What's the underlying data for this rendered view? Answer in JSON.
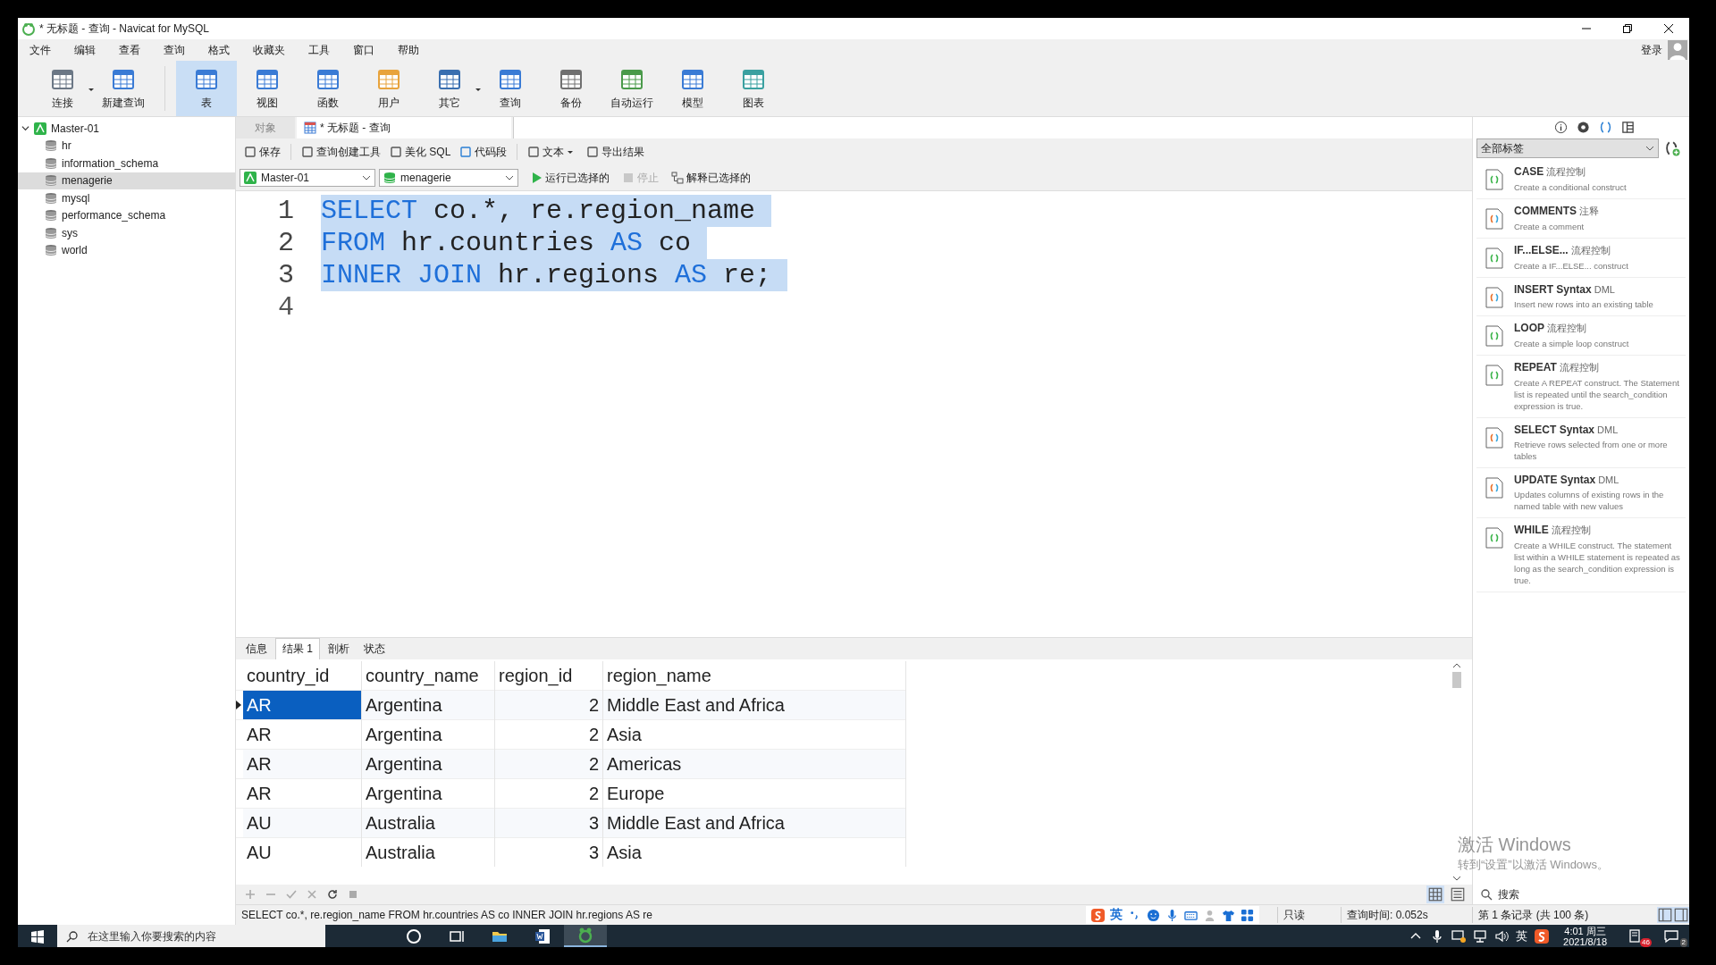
{
  "window": {
    "title": "* 无标题 - 查询 - Navicat for MySQL"
  },
  "menu": [
    "文件",
    "编辑",
    "查看",
    "查询",
    "格式",
    "收藏夹",
    "工具",
    "窗口",
    "帮助"
  ],
  "login": "登录",
  "toolbar": [
    {
      "label": "连接",
      "selected": false,
      "dropdown": true
    },
    {
      "label": "新建查询",
      "selected": false,
      "dropdown": false
    },
    {
      "label": "表",
      "selected": true,
      "dropdown": false
    },
    {
      "label": "视图",
      "selected": false,
      "dropdown": false
    },
    {
      "label": "函数",
      "selected": false,
      "dropdown": false
    },
    {
      "label": "用户",
      "selected": false,
      "dropdown": false
    },
    {
      "label": "其它",
      "selected": false,
      "dropdown": true
    },
    {
      "label": "查询",
      "selected": false,
      "dropdown": false
    },
    {
      "label": "备份",
      "selected": false,
      "dropdown": false
    },
    {
      "label": "自动运行",
      "selected": false,
      "dropdown": false
    },
    {
      "label": "模型",
      "selected": false,
      "dropdown": false
    },
    {
      "label": "图表",
      "selected": false,
      "dropdown": false
    }
  ],
  "tree": {
    "label": "Master-01",
    "expanded": true,
    "children": [
      {
        "label": "hr",
        "selected": false
      },
      {
        "label": "information_schema",
        "selected": false
      },
      {
        "label": "menagerie",
        "selected": true
      },
      {
        "label": "mysql",
        "selected": false
      },
      {
        "label": "performance_schema",
        "selected": false
      },
      {
        "label": "sys",
        "selected": false
      },
      {
        "label": "world",
        "selected": false
      }
    ]
  },
  "doc_tabs": [
    {
      "label": "对象",
      "selected": false
    },
    {
      "label": "* 无标题 - 查询",
      "selected": true
    }
  ],
  "query_toolbar": [
    {
      "label": "保存",
      "dropdown": false
    },
    {
      "label": "查询创建工具",
      "dropdown": false
    },
    {
      "label": "美化 SQL",
      "dropdown": false
    },
    {
      "label": "代码段",
      "dropdown": false
    },
    {
      "label": "文本",
      "dropdown": true
    },
    {
      "label": "导出结果",
      "dropdown": false
    }
  ],
  "connection": "Master-01",
  "database": "menagerie",
  "run_actions": [
    {
      "label": "运行已选择的",
      "disabled": false
    },
    {
      "label": "停止",
      "disabled": true
    },
    {
      "label": "解释已选择的",
      "disabled": false
    }
  ],
  "editor": {
    "lines": [
      {
        "number": "1",
        "selected": true,
        "tokens": [
          {
            "kind": "keyword",
            "text": "SELECT"
          },
          {
            "kind": "plain",
            "text": " co.*, re.region_name"
          }
        ]
      },
      {
        "number": "2",
        "selected": true,
        "tokens": [
          {
            "kind": "keyword",
            "text": "FROM"
          },
          {
            "kind": "plain",
            "text": " hr.countries "
          },
          {
            "kind": "keyword",
            "text": "AS"
          },
          {
            "kind": "plain",
            "text": " co"
          }
        ]
      },
      {
        "number": "3",
        "selected": true,
        "tokens": [
          {
            "kind": "keyword",
            "text": "INNER JOIN"
          },
          {
            "kind": "plain",
            "text": " hr.regions "
          },
          {
            "kind": "keyword",
            "text": "AS"
          },
          {
            "kind": "plain",
            "text": " re;"
          }
        ]
      },
      {
        "number": "4",
        "selected": false
      }
    ]
  },
  "result_tabs": [
    {
      "label": "信息",
      "selected": false
    },
    {
      "label": "结果 1",
      "selected": true
    },
    {
      "label": "剖析",
      "selected": false
    },
    {
      "label": "状态",
      "selected": false
    }
  ],
  "grid": {
    "columns": [
      {
        "label": "country_id",
        "numeric": false
      },
      {
        "label": "country_name",
        "numeric": false
      },
      {
        "label": "region_id",
        "numeric": true
      },
      {
        "label": "region_name",
        "numeric": false
      }
    ],
    "rows": [
      {
        "cells": [
          "AR",
          "Argentina",
          "2",
          "Middle East and Africa"
        ],
        "current": true
      },
      {
        "cells": [
          "AR",
          "Argentina",
          "2",
          "Asia"
        ],
        "current": false
      },
      {
        "cells": [
          "AR",
          "Argentina",
          "2",
          "Americas"
        ],
        "current": false
      },
      {
        "cells": [
          "AR",
          "Argentina",
          "2",
          "Europe"
        ],
        "current": false
      },
      {
        "cells": [
          "AU",
          "Australia",
          "3",
          "Middle East and Africa"
        ],
        "current": false
      },
      {
        "cells": [
          "AU",
          "Australia",
          "3",
          "Asia"
        ],
        "current": false
      }
    ]
  },
  "view_toggles": [
    {
      "selected": true
    },
    {
      "selected": false
    }
  ],
  "status_bar": {
    "sql": "SELECT co.*, re.region_name  FROM hr.countries AS co  INNER JOIN hr.regions AS re",
    "mode": "只读",
    "query_time": "查询时间: 0.052s",
    "record": "第 1 条记录 (共 100 条)"
  },
  "ime": {
    "label": "英"
  },
  "panel_tabs": [
    {
      "selected": false
    },
    {
      "selected": false
    },
    {
      "selected": true
    },
    {
      "selected": false
    }
  ],
  "filter": "全部标签",
  "snippets": [
    {
      "name": "CASE",
      "tag": "流程控制",
      "description": "Create a conditional construct",
      "kind": "flow"
    },
    {
      "name": "COMMENTS",
      "tag": "注释",
      "description": "Create a comment",
      "kind": "other"
    },
    {
      "name": "IF...ELSE...",
      "tag": "流程控制",
      "description": "Create a IF...ELSE... construct",
      "kind": "flow"
    },
    {
      "name": "INSERT Syntax",
      "tag": "DML",
      "description": "Insert new rows into an existing table",
      "kind": "other"
    },
    {
      "name": "LOOP",
      "tag": "流程控制",
      "description": "Create a simple loop construct",
      "kind": "flow"
    },
    {
      "name": "REPEAT",
      "tag": "流程控制",
      "description": "Create A REPEAT construct. The Statement list is repeated until the search_condition expression is true.",
      "kind": "flow"
    },
    {
      "name": "SELECT Syntax",
      "tag": "DML",
      "description": "Retrieve rows selected from one or more tables",
      "kind": "other"
    },
    {
      "name": "UPDATE Syntax",
      "tag": "DML",
      "description": "Updates columns of existing rows in the named table with new values",
      "kind": "other"
    },
    {
      "name": "WHILE",
      "tag": "流程控制",
      "description": "Create a WHILE construct. The statement list within a WHILE statement is repeated as long as the search_condition expression is true.",
      "kind": "flow"
    }
  ],
  "search": {
    "placeholder": "搜索"
  },
  "activation": {
    "title": "激活 Windows",
    "hint": "转到“设置”以激活 Windows。"
  },
  "taskbar": {
    "search_placeholder": "在这里输入你要搜索的内容",
    "apps": [
      {
        "selected": false
      },
      {
        "selected": false
      },
      {
        "selected": false
      },
      {
        "selected": false
      },
      {
        "selected": true
      }
    ],
    "lang": "英",
    "time": "4:01 周三",
    "date": "2021/8/18",
    "notifications": "46",
    "action_center": "2"
  }
}
